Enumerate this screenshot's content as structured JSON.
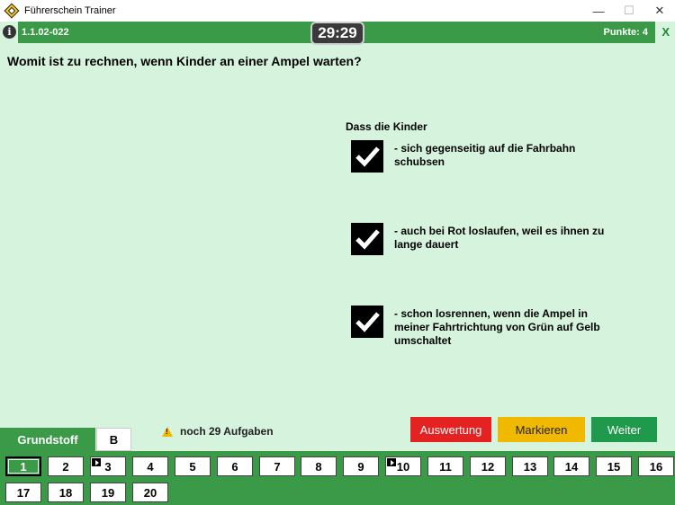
{
  "window": {
    "title": "Führerschein Trainer",
    "minimize": "—",
    "maximize": "☐",
    "close": "✕"
  },
  "header": {
    "question_id": "1.1.02-022",
    "timer": "29:29",
    "points": "Punkte: 4",
    "exit": "X",
    "info_icon": "i"
  },
  "question": {
    "text": "Womit ist zu rechnen, wenn Kinder an einer Ampel warten?",
    "stem": "Dass die Kinder",
    "answers": [
      {
        "text": "- sich gegenseitig auf die Fahrbahn schubsen",
        "checked": true
      },
      {
        "text": "- auch bei Rot loslaufen, weil es ihnen zu lange dauert",
        "checked": true
      },
      {
        "text": "- schon losrennen, wenn die Ampel in meiner Fahrtrichtung von Grün auf Gelb umschaltet",
        "checked": true
      }
    ]
  },
  "tabs": {
    "grundstoff": "Grundstoff",
    "b": "B"
  },
  "status": {
    "remaining": "noch 29 Aufgaben"
  },
  "actions": {
    "auswertung": "Auswertung",
    "markieren": "Markieren",
    "weiter": "Weiter"
  },
  "navigation": {
    "numbers": [
      "1",
      "2",
      "3",
      "4",
      "5",
      "6",
      "7",
      "8",
      "9",
      "10",
      "11",
      "12",
      "13",
      "14",
      "15",
      "16",
      "17",
      "18",
      "19",
      "20"
    ],
    "current": "1",
    "marked": [
      "3",
      "10"
    ]
  },
  "colors": {
    "background": "#d6f3dd",
    "green": "#3a9a47",
    "red": "#e52222",
    "yellow": "#f1b800",
    "weiter_green": "#1f9a4c"
  }
}
